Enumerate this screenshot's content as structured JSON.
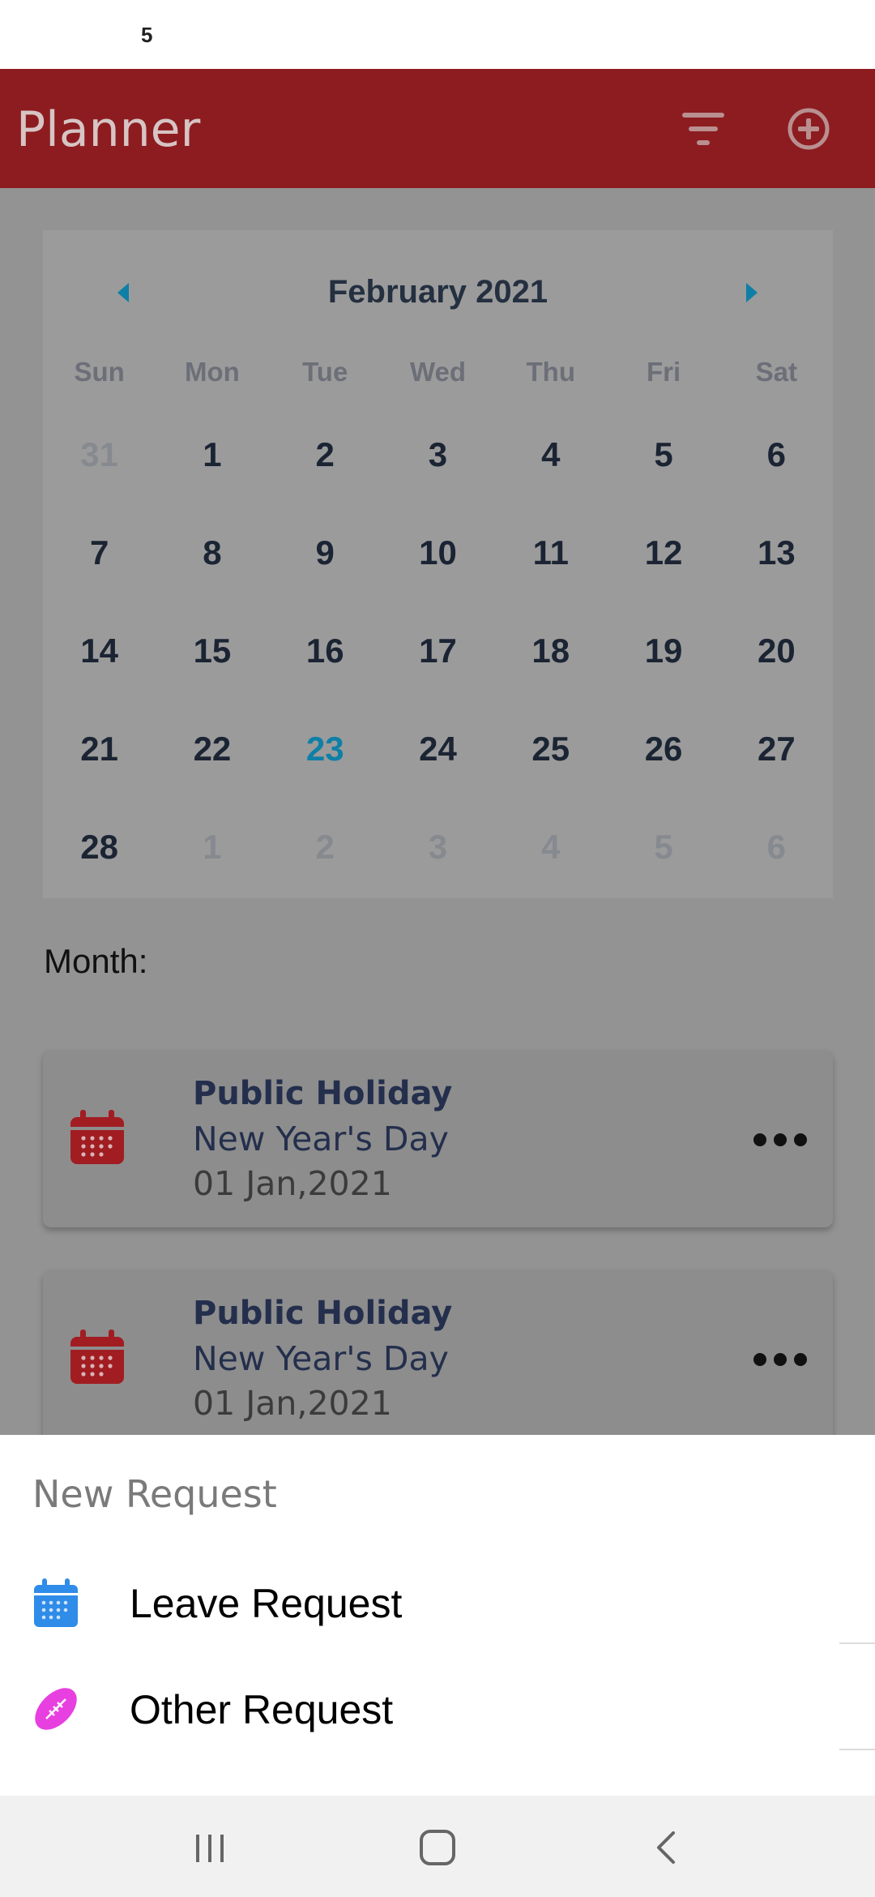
{
  "status_bar": {
    "notification": "5"
  },
  "app_bar": {
    "title": "Planner",
    "filter_icon": "filter-icon",
    "add_icon": "add-circle-icon"
  },
  "calendar": {
    "month_title": "February 2021",
    "weekdays": [
      "Sun",
      "Mon",
      "Tue",
      "Wed",
      "Thu",
      "Fri",
      "Sat"
    ],
    "weeks": [
      [
        "31",
        "1",
        "2",
        "3",
        "4",
        "5",
        "6"
      ],
      [
        "7",
        "8",
        "9",
        "10",
        "11",
        "12",
        "13"
      ],
      [
        "14",
        "15",
        "16",
        "17",
        "18",
        "19",
        "20"
      ],
      [
        "21",
        "22",
        "23",
        "24",
        "25",
        "26",
        "27"
      ],
      [
        "28",
        "1",
        "2",
        "3",
        "4",
        "5",
        "6"
      ]
    ],
    "today": "23",
    "accent_color": "#0e7fa6"
  },
  "month_section": {
    "label": "Month:"
  },
  "events": [
    {
      "type": "Public Holiday",
      "name": "New Year's Day",
      "date": "01 Jan,2021",
      "icon": "calendar-icon"
    },
    {
      "type": "Public Holiday",
      "name": "New Year's Day",
      "date": "01 Jan,2021",
      "icon": "calendar-icon"
    }
  ],
  "new_request_sheet": {
    "title": "New Request",
    "items": [
      {
        "label": "Leave Request",
        "icon": "calendar-icon",
        "color": "#2f8ce8"
      },
      {
        "label": "Other Request",
        "icon": "football-icon",
        "color": "#e83fe0"
      }
    ]
  },
  "colors": {
    "brand": "#8c1c20",
    "event_icon": "#a11d22"
  },
  "nav_bar": {
    "recent_icon": "recent-apps-icon",
    "home_icon": "home-icon",
    "back_icon": "back-icon"
  }
}
